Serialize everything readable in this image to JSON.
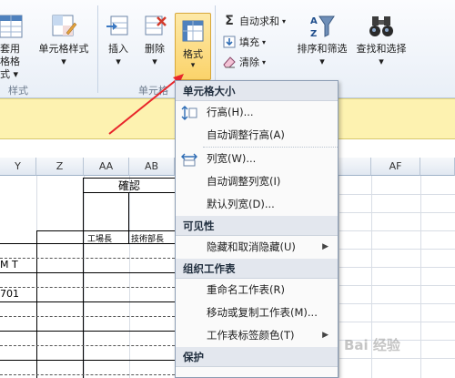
{
  "ribbon": {
    "tao_yong": "套用",
    "biao_ge_shi": "格格式",
    "cell_style": "单元格样式",
    "style_group": "样式",
    "insert": "插入",
    "delete": "删除",
    "format": "格式",
    "cells_group": "单元格",
    "autosum": "自动求和",
    "fill": "填充",
    "clear": "清除",
    "sort_filter": "排序和筛选",
    "find_select": "查找和选择"
  },
  "columns": [
    "Y",
    "Z",
    "AA",
    "AB",
    "AF"
  ],
  "sheet": {
    "kakunin": "確認",
    "kojocho": "工場長",
    "gijutsu": "技術部長",
    "mt": "M T",
    "num": "701"
  },
  "menu": {
    "sec_size": "单元格大小",
    "row_height": "行高(H)...",
    "autofit_row": "自动调整行高(A)",
    "col_width": "列宽(W)...",
    "autofit_col": "自动调整列宽(I)",
    "default_width": "默认列宽(D)...",
    "sec_visibility": "可见性",
    "hide_unhide": "隐藏和取消隐藏(U)",
    "sec_organize": "组织工作表",
    "rename": "重命名工作表(R)",
    "move_copy": "移动或复制工作表(M)...",
    "tab_color": "工作表标签颜色(T)",
    "sec_protect": "保护"
  },
  "watermark": "Bai 经验"
}
